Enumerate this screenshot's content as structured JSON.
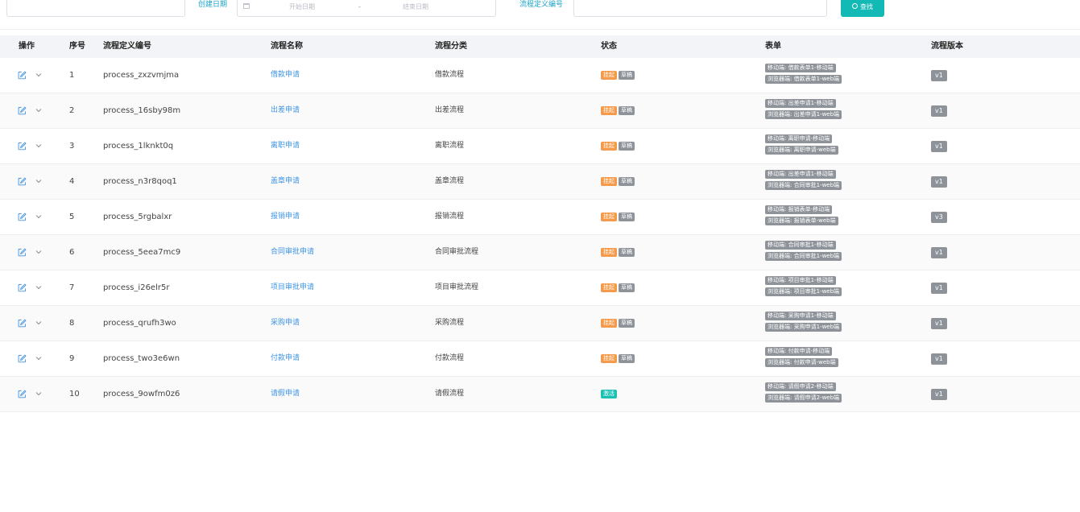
{
  "filters": {
    "first_input_value": "",
    "date_label": "创建日期",
    "start_placeholder": "开始日期",
    "range_separator": "-",
    "end_placeholder": "结束日期",
    "code_label": "流程定义编号",
    "code_value": "",
    "search_label": "查找"
  },
  "table": {
    "headers": {
      "action": "操作",
      "index": "序号",
      "code": "流程定义编号",
      "name": "流程名称",
      "category": "流程分类",
      "status": "状态",
      "form": "表单",
      "version": "流程版本"
    },
    "rows": [
      {
        "index": "1",
        "code": "process_zxzvmjma",
        "name": "借款申请",
        "category": "借款流程",
        "status": [
          "挂起",
          "草稿"
        ],
        "forms": [
          "移动端: 借款表单1-移动端",
          "浏览器端: 借款表单1-web端"
        ],
        "version": "v1"
      },
      {
        "index": "2",
        "code": "process_16sby98m",
        "name": "出差申请",
        "category": "出差流程",
        "status": [
          "挂起",
          "草稿"
        ],
        "forms": [
          "移动端: 出差申请1-移动端",
          "浏览器端: 出差申请1-web端"
        ],
        "version": "v1"
      },
      {
        "index": "3",
        "code": "process_1lknkt0q",
        "name": "离职申请",
        "category": "离职流程",
        "status": [
          "挂起",
          "草稿"
        ],
        "forms": [
          "移动端: 离职申请-移动端",
          "浏览器端: 离职申请-web端"
        ],
        "version": "v1"
      },
      {
        "index": "4",
        "code": "process_n3r8qoq1",
        "name": "盖章申请",
        "category": "盖章流程",
        "status": [
          "挂起",
          "草稿"
        ],
        "forms": [
          "移动端: 出差申请1-移动端",
          "浏览器端: 合同审批1-web端"
        ],
        "version": "v1"
      },
      {
        "index": "5",
        "code": "process_5rgbalxr",
        "name": "报销申请",
        "category": "报销流程",
        "status": [
          "挂起",
          "草稿"
        ],
        "forms": [
          "移动端: 报销表单-移动端",
          "浏览器端: 报销表单-web端"
        ],
        "version": "v3"
      },
      {
        "index": "6",
        "code": "process_5eea7mc9",
        "name": "合同审批申请",
        "category": "合同审批流程",
        "status": [
          "挂起",
          "草稿"
        ],
        "forms": [
          "移动端: 合同审批1-移动端",
          "浏览器端: 合同审批1-web端"
        ],
        "version": "v1"
      },
      {
        "index": "7",
        "code": "process_i26elr5r",
        "name": "项目审批申请",
        "category": "项目审批流程",
        "status": [
          "挂起",
          "草稿"
        ],
        "forms": [
          "移动端: 项目审批1-移动端",
          "浏览器端: 项目审批1-web端"
        ],
        "version": "v1"
      },
      {
        "index": "8",
        "code": "process_qrufh3wo",
        "name": "采购申请",
        "category": "采购流程",
        "status": [
          "挂起",
          "草稿"
        ],
        "forms": [
          "移动端: 采购申请1-移动端",
          "浏览器端: 采购申请1-web端"
        ],
        "version": "v1"
      },
      {
        "index": "9",
        "code": "process_two3e6wn",
        "name": "付款申请",
        "category": "付款流程",
        "status": [
          "挂起",
          "草稿"
        ],
        "forms": [
          "移动端: 付款申请-移动端",
          "浏览器端: 付款申请-web端"
        ],
        "version": "v1"
      },
      {
        "index": "10",
        "code": "process_9owfm0z6",
        "name": "请假申请",
        "category": "请假流程",
        "status": [
          "激活"
        ],
        "forms": [
          "移动端: 请假申请2-移动端",
          "浏览器端: 请假申请2-web端"
        ],
        "version": "v1"
      }
    ]
  },
  "colors": {
    "accent": "#13b9b5",
    "link": "#3e94e4",
    "suspended": "#f59a4a",
    "draft": "#8e9399",
    "active": "#1bbfb4"
  }
}
